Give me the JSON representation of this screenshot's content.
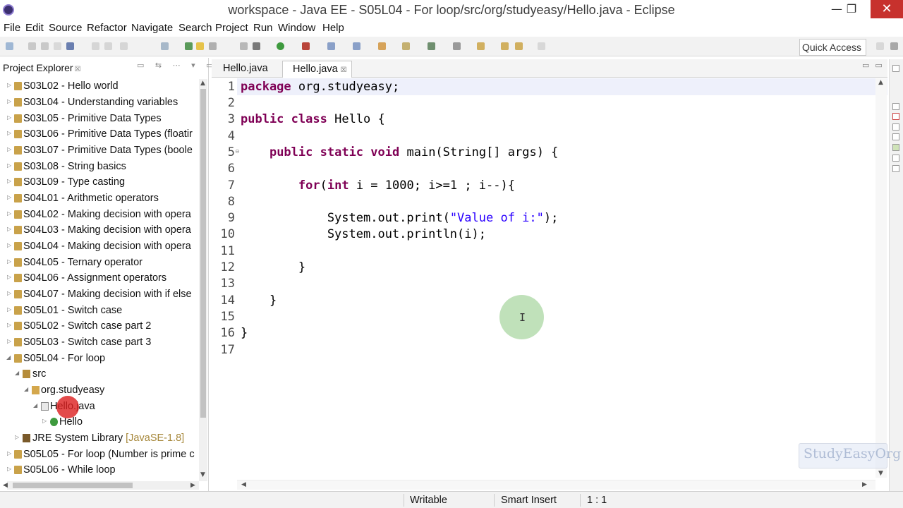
{
  "window": {
    "title": "workspace - Java EE - S05L04 - For loop/src/org/studyeasy/Hello.java - Eclipse",
    "minimize": "—",
    "maximize": "❐",
    "close": "✕"
  },
  "menu": [
    "File",
    "Edit",
    "Source",
    "Refactor",
    "Navigate",
    "Search",
    "Project",
    "Run",
    "Window",
    "Help"
  ],
  "toolbar": {
    "quick_access": "Quick Access"
  },
  "project_explorer": {
    "title": "Project Explorer",
    "close": "☒",
    "items": [
      {
        "label": "S03L02 - Hello world",
        "icon": "project-icon",
        "expanded": false
      },
      {
        "label": "S03L04 - Understanding variables",
        "icon": "project-icon",
        "expanded": false
      },
      {
        "label": "S03L05 - Primitive Data Types",
        "icon": "project-icon",
        "expanded": false
      },
      {
        "label": "S03L06 - Primitive Data Types (floatir",
        "icon": "project-icon",
        "expanded": false
      },
      {
        "label": "S03L07 - Primitive Data Types (boole",
        "icon": "project-icon",
        "expanded": false
      },
      {
        "label": "S03L08 - String basics",
        "icon": "project-icon",
        "expanded": false
      },
      {
        "label": "S03L09 - Type casting",
        "icon": "project-icon",
        "expanded": false
      },
      {
        "label": "S04L01 - Arithmetic operators",
        "icon": "project-icon",
        "expanded": false
      },
      {
        "label": "S04L02 - Making decision with opera",
        "icon": "project-icon",
        "expanded": false
      },
      {
        "label": "S04L03 - Making decision with opera",
        "icon": "project-icon",
        "expanded": false
      },
      {
        "label": "S04L04 - Making decision with opera",
        "icon": "project-icon",
        "expanded": false
      },
      {
        "label": "S04L05 - Ternary operator",
        "icon": "project-icon",
        "expanded": false
      },
      {
        "label": "S04L06 - Assignment operators",
        "icon": "project-icon",
        "expanded": false
      },
      {
        "label": "S04L07 - Making decision with if else",
        "icon": "project-icon",
        "expanded": false
      },
      {
        "label": "S05L01 - Switch case",
        "icon": "project-icon",
        "expanded": false
      },
      {
        "label": "S05L02 - Switch case part 2",
        "icon": "project-icon",
        "expanded": false
      },
      {
        "label": "S05L03 - Switch case part 3",
        "icon": "project-icon",
        "expanded": false
      },
      {
        "label": "S05L04 - For loop",
        "icon": "project-icon",
        "expanded": true
      },
      {
        "label": "src",
        "icon": "source-folder-icon",
        "expanded": true
      },
      {
        "label": "org.studyeasy",
        "icon": "package-icon",
        "expanded": true
      },
      {
        "label": "Hello.java",
        "icon": "java-file-icon",
        "expanded": true
      },
      {
        "label": "Hello",
        "icon": "class-icon",
        "expanded": false
      },
      {
        "label": "JRE System Library",
        "tag": "[JavaSE-1.8]",
        "icon": "library-icon",
        "expanded": false
      },
      {
        "label": "S05L05 - For loop (Number is prime c",
        "icon": "project-icon",
        "expanded": false
      },
      {
        "label": "S05L06 - While loop",
        "icon": "project-icon",
        "expanded": false
      }
    ]
  },
  "editor": {
    "tabs": [
      {
        "label": "Hello.java",
        "active": false
      },
      {
        "label": "Hello.java",
        "active": true,
        "close": "☒"
      }
    ],
    "line_numbers": [
      "1",
      "2",
      "3",
      "4",
      "5",
      "6",
      "7",
      "8",
      "9",
      "10",
      "11",
      "12",
      "13",
      "14",
      "15",
      "16",
      "17"
    ]
  },
  "status_bar": {
    "mode": "Writable",
    "insert": "Smart Insert",
    "position": "1 : 1"
  },
  "watermark": "StudyEasyOrg",
  "colors": {
    "keyword": "#7f0055",
    "string": "#2a00ff",
    "close_button": "#c7312d",
    "click_highlight": "#dc1e1e",
    "cursor_highlight": "#8cc882"
  }
}
